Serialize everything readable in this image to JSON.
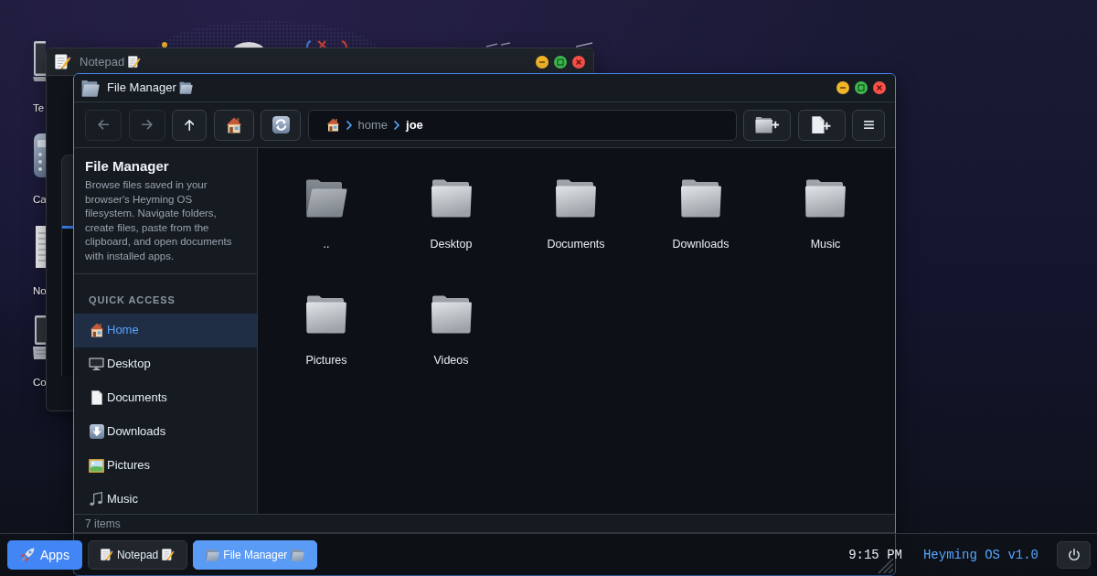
{
  "desktop_icons": [
    {
      "kind": "laptop",
      "label": "Te"
    },
    {
      "kind": "calculator",
      "label": "Ca"
    },
    {
      "kind": "notepad",
      "label": "No"
    },
    {
      "kind": "laptop",
      "label": "Co"
    }
  ],
  "notepad_window": {
    "title": "Notepad",
    "focused": false
  },
  "file_manager_window": {
    "title": "File Manager",
    "focused": true,
    "toolbar": {
      "buttons": [
        {
          "kind": "back",
          "disabled": true
        },
        {
          "kind": "forward",
          "disabled": true
        },
        {
          "kind": "up",
          "disabled": false
        },
        {
          "kind": "home",
          "disabled": false
        },
        {
          "kind": "refresh",
          "disabled": false
        }
      ],
      "actions": [
        {
          "kind": "new_folder"
        },
        {
          "kind": "new_file"
        },
        {
          "kind": "menu"
        }
      ]
    },
    "path": [
      {
        "label": "home",
        "current": false
      },
      {
        "label": "joe",
        "current": true
      }
    ],
    "sidebar": {
      "title": "File Manager",
      "description": "Browse files saved in your browser's Heyming OS filesystem. Navigate folders, create files, paste from the clipboard, and open documents with installed apps.",
      "section": "QUICK ACCESS",
      "items": [
        {
          "kind": "home",
          "label": "Home",
          "selected": true
        },
        {
          "kind": "desktop",
          "label": "Desktop",
          "selected": false
        },
        {
          "kind": "documents",
          "label": "Documents",
          "selected": false
        },
        {
          "kind": "downloads",
          "label": "Downloads",
          "selected": false
        },
        {
          "kind": "pictures",
          "label": "Pictures",
          "selected": false
        },
        {
          "kind": "music",
          "label": "Music",
          "selected": false
        }
      ]
    },
    "files": [
      {
        "kind": "parent",
        "name": ".."
      },
      {
        "kind": "folder",
        "name": "Desktop"
      },
      {
        "kind": "folder",
        "name": "Documents"
      },
      {
        "kind": "folder",
        "name": "Downloads"
      },
      {
        "kind": "folder",
        "name": "Music"
      },
      {
        "kind": "folder",
        "name": "Pictures"
      },
      {
        "kind": "folder",
        "name": "Videos"
      }
    ],
    "status": "7 items"
  },
  "taskbar": {
    "start_button": "Apps",
    "apps": [
      {
        "kind": "notepad",
        "label": "Notepad",
        "selected": false
      },
      {
        "kind": "file_manager",
        "label": "File Manager",
        "selected": true
      }
    ],
    "clock": "9:15 PM",
    "version": "Heyming OS v1.0"
  }
}
